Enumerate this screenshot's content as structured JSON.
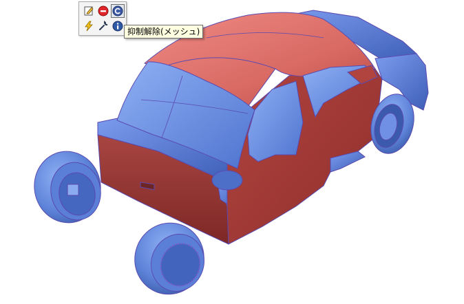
{
  "viewport": {
    "description_label": ""
  },
  "toolbar": {
    "buttons": [
      {
        "name": "edit-sketch-icon"
      },
      {
        "name": "suppress-icon"
      },
      {
        "name": "unsuppress-icon",
        "active": true
      },
      {
        "name": "lightning-icon"
      },
      {
        "name": "wrench-icon"
      },
      {
        "name": "info-icon"
      }
    ]
  },
  "tooltip": {
    "text": "抑制解除(メッシュ)"
  },
  "colors": {
    "body_red": "#c85a55",
    "body_blue": "#5c82d8",
    "edge": "#5a4ab0",
    "tooltip_bg": "#ffffe1"
  }
}
